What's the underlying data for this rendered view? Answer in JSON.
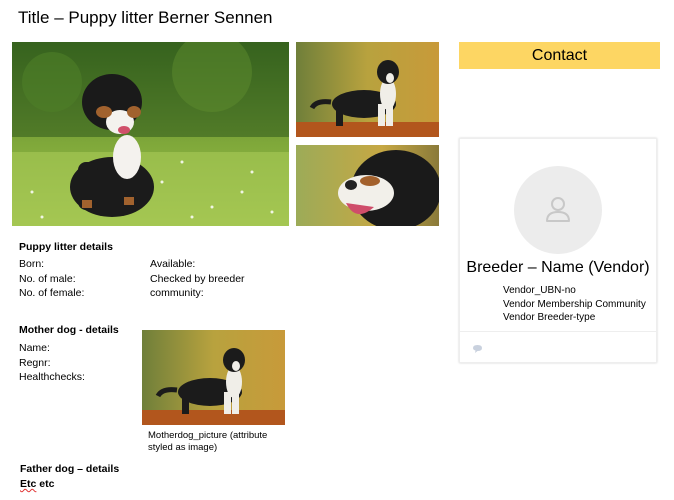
{
  "title": "Title – Puppy litter Berner Sennen",
  "contact": {
    "label": "Contact"
  },
  "vendor_card": {
    "name": "Breeder – Name (Vendor)",
    "lines": [
      "Vendor_UBN-no",
      "Vendor Membership Community",
      "Vendor Breeder-type"
    ]
  },
  "litter": {
    "heading": "Puppy litter details",
    "left": [
      "Born:",
      "No. of male:",
      "No. of female:"
    ],
    "right": [
      "Available:",
      "Checked by breeder",
      "community:"
    ]
  },
  "mother": {
    "heading": "Mother dog - details",
    "fields": [
      "Name:",
      "Regnr:",
      "Healthchecks:"
    ],
    "caption": [
      "Motherdog_picture (attribute",
      "styled as image)"
    ]
  },
  "father": {
    "heading": "Father dog – details",
    "note_word1": "Etc",
    "note_word2": "etc"
  },
  "icons": {
    "avatar": "user-avatar-icon",
    "comment": "speech-bubble-icon"
  }
}
